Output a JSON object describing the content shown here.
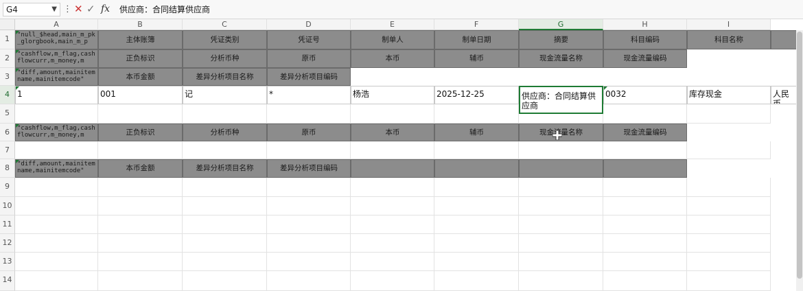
{
  "formula_bar": {
    "name_box": "G4",
    "fx_label": "fx",
    "formula": "供应商：合同结算供应商"
  },
  "columns": [
    "A",
    "B",
    "C",
    "D",
    "E",
    "F",
    "G",
    "H",
    "I"
  ],
  "selected_column": "G",
  "rows": [
    "1",
    "2",
    "3",
    "4",
    "5",
    "6",
    "7",
    "8",
    "9",
    "10",
    "11",
    "12",
    "13",
    "14"
  ],
  "selected_row": "4",
  "cells": {
    "r1": {
      "A": "\"null_$head,main_m_pk_glorgbook,main_m_p",
      "B": "主体账簿",
      "C": "凭证类别",
      "D": "凭证号",
      "E": "制单人",
      "F": "制单日期",
      "G": "摘要",
      "H": "科目编码",
      "I": "科目名称"
    },
    "r2": {
      "A": "\"cashflow,m_flag,cashflowcurr,m_money,m",
      "B": "正负标识",
      "C": "分析币种",
      "D": "原币",
      "E": "本币",
      "F": "辅币",
      "G": "现金流量名称",
      "H": "现金流量编码"
    },
    "r3": {
      "A": "\"diff,amount,mainitemname,mainitemcode\"",
      "B": "本币金额",
      "C": "差异分析项目名称",
      "D": "差异分析项目编码"
    },
    "r4": {
      "A": "1",
      "B": "001",
      "C": "记",
      "D": "*",
      "E": "杨浩",
      "F": "2025-12-25",
      "G": "供应商：合同结算供应商",
      "H": "0032",
      "I": "库存现金",
      "J": "人民币"
    },
    "r6": {
      "A": "\"cashflow,m_flag,cashflowcurr,m_money,m",
      "B": "正负标识",
      "C": "分析币种",
      "D": "原币",
      "E": "本币",
      "F": "辅币",
      "G": "现金流量名称",
      "H": "现金流量编码"
    },
    "r8": {
      "A": "\"diff,amount,mainitemname,mainitemcode\"",
      "B": "本币金额",
      "C": "差异分析项目名称",
      "D": "差异分析项目编码"
    }
  },
  "colors": {
    "accent": "#1e7b34",
    "header_fill": "#8c8c8c",
    "cancel": "#cc3333"
  }
}
